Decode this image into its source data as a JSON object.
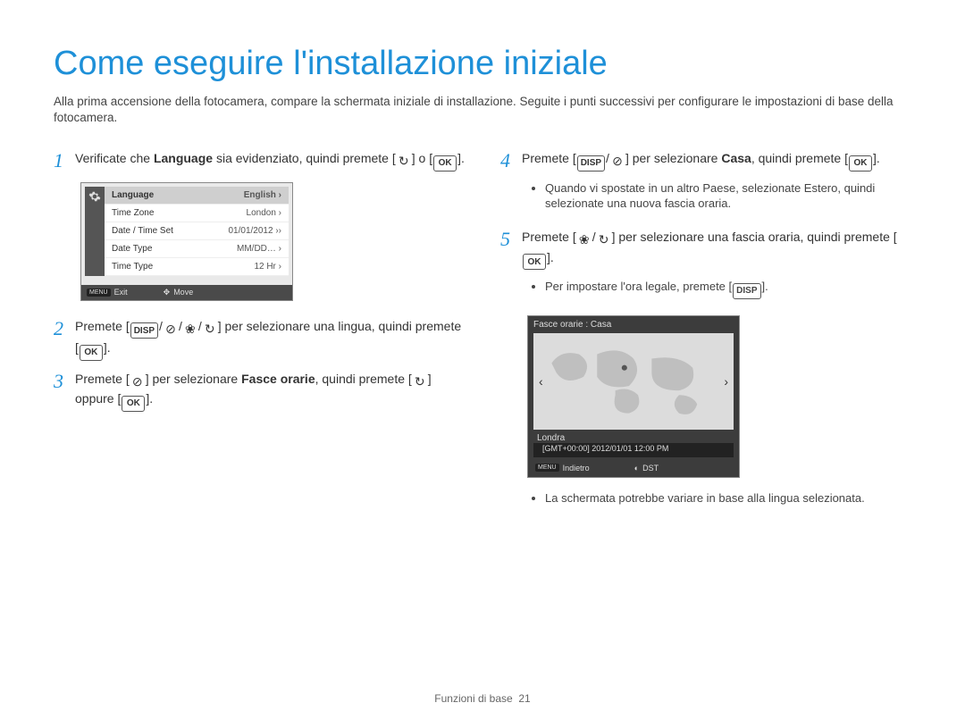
{
  "title": "Come eseguire l'installazione iniziale",
  "intro": "Alla prima accensione della fotocamera, compare la schermata iniziale di installazione. Seguite i punti successivi per configurare le impostazioni di base della fotocamera.",
  "buttons": {
    "ok": "OK",
    "disp": "DISP",
    "menu": "MENU",
    "timer": "⏲",
    "flash": "⚡",
    "macro": "❀"
  },
  "steps": {
    "s1a": "Verificate che ",
    "s1b": "Language",
    "s1c": " sia evidenziato, quindi premete ",
    "s1d": " o ",
    "s1e": ".",
    "s2a": "Premete ",
    "s2b": " per selezionare una lingua, quindi premete ",
    "s2c": ".",
    "s3a": "Premete ",
    "s3b": " per selezionare ",
    "s3c": "Fasce orarie",
    "s3d": ", quindi premete ",
    "s3e": " oppure ",
    "s3f": ".",
    "s4a": "Premete ",
    "s4b": " per selezionare ",
    "s4c": "Casa",
    "s4d": ", quindi premete ",
    "s4e": ".",
    "s4bullet_a": "Quando vi spostate in un altro Paese, selezionate ",
    "s4bullet_b": "Estero",
    "s4bullet_c": ", quindi selezionate una nuova fascia oraria.",
    "s5a": "Premete ",
    "s5b": " per selezionare una fascia oraria, quindi premete ",
    "s5c": ".",
    "s5bullet_a": "Per impostare l'ora legale, premete ",
    "s5bullet_b": ".",
    "s5note": "La schermata potrebbe variare in base alla lingua selezionata."
  },
  "screen1": {
    "rows": [
      {
        "k": "Language",
        "v": "English ›"
      },
      {
        "k": "Time Zone",
        "v": "London ›"
      },
      {
        "k": "Date / Time Set",
        "v": "01/01/2012 ››"
      },
      {
        "k": "Date Type",
        "v": "MM/DD… ›"
      },
      {
        "k": "Time Type",
        "v": "12 Hr ›"
      }
    ],
    "foot_exit": "Exit",
    "foot_move": "Move",
    "menu_tag": "MENU"
  },
  "screen2": {
    "title": "Fasce orarie : Casa",
    "city": "Londra",
    "gmt": "[GMT+00:00]  2012/01/01  12:00 PM",
    "foot_back": "Indietro",
    "foot_dst": "DST",
    "menu_tag": "MENU"
  },
  "footer": {
    "section": "Funzioni di base",
    "page": "21"
  }
}
